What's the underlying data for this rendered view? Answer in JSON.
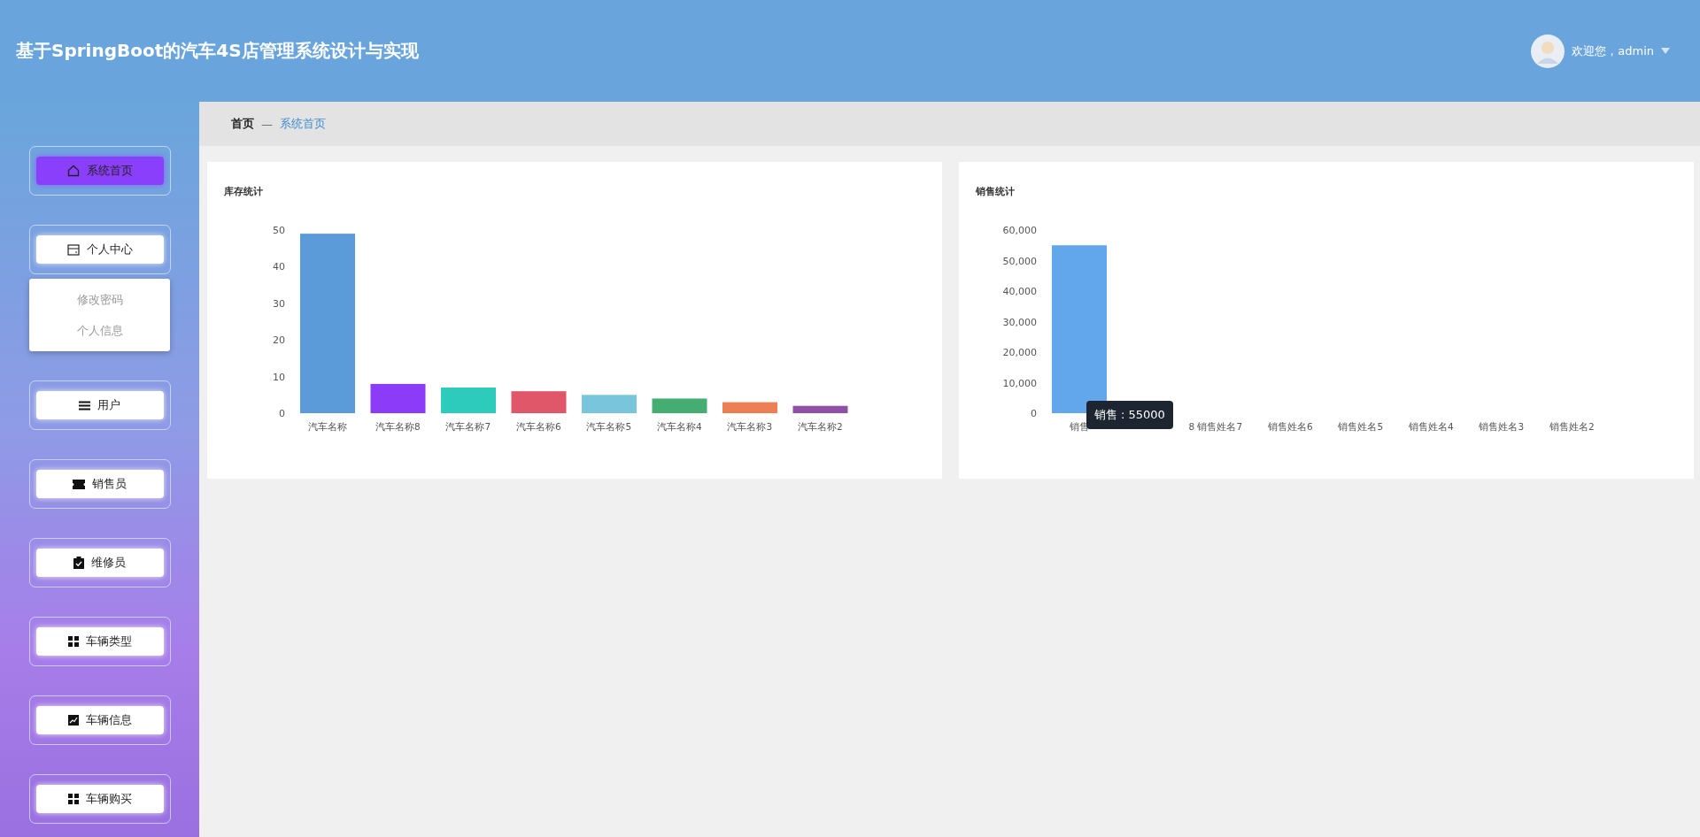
{
  "header": {
    "title": "基于SpringBoot的汽车4S店管理系统设计与实现",
    "user": {
      "greeting": "欢迎您，admin"
    }
  },
  "sidebar": {
    "items": [
      {
        "label": "系统首页",
        "selected": true
      },
      {
        "label": "个人中心",
        "selected": false,
        "expanded": true,
        "children": [
          {
            "label": "修改密码"
          },
          {
            "label": "个人信息"
          }
        ]
      },
      {
        "label": "用户",
        "selected": false
      },
      {
        "label": "销售员",
        "selected": false
      },
      {
        "label": "维修员",
        "selected": false
      },
      {
        "label": "车辆类型",
        "selected": false
      },
      {
        "label": "车辆信息",
        "selected": false
      },
      {
        "label": "车辆购买",
        "selected": false
      }
    ]
  },
  "breadcrumb": {
    "items": [
      "首页",
      "系统首页"
    ],
    "separator": "—"
  },
  "cards": [
    {
      "title": "库存统计",
      "chart_data": {
        "type": "bar",
        "categories": [
          "汽车名称",
          "汽车名称8",
          "汽车名称7",
          "汽车名称6",
          "汽车名称5",
          "汽车名称4",
          "汽车名称3",
          "汽车名称2"
        ],
        "values": [
          49,
          8,
          7,
          6,
          5,
          4,
          3,
          2
        ],
        "colors": [
          "#5b9bd9",
          "#8c3cf8",
          "#2ccbbc",
          "#e0576a",
          "#79c5dc",
          "#44ad72",
          "#ee7f55",
          "#9050a8"
        ],
        "ylim": [
          0,
          50
        ],
        "yticks": [
          0,
          10,
          20,
          30,
          40,
          50
        ]
      }
    },
    {
      "title": "销售统计",
      "chart_data": {
        "type": "bar",
        "categories": [
          "销售",
          "8",
          "销售姓名7",
          "销售姓名6",
          "销售姓名5",
          "销售姓名4",
          "销售姓名3",
          "销售姓名2"
        ],
        "values": [
          55000,
          0,
          0,
          0,
          0,
          0,
          0,
          0
        ],
        "color": "#62a7eb",
        "ylim": [
          0,
          60000
        ],
        "yticks": [
          {
            "value": 0,
            "label": "0"
          },
          {
            "value": 10000,
            "label": "10,000"
          },
          {
            "value": 20000,
            "label": "20,000"
          },
          {
            "value": 30000,
            "label": "30,000"
          },
          {
            "value": 40000,
            "label": "40,000"
          },
          {
            "value": 50000,
            "label": "50,000"
          },
          {
            "value": 60000,
            "label": "60,000"
          }
        ]
      },
      "tooltip": {
        "text": "销售 : 55000"
      }
    }
  ]
}
